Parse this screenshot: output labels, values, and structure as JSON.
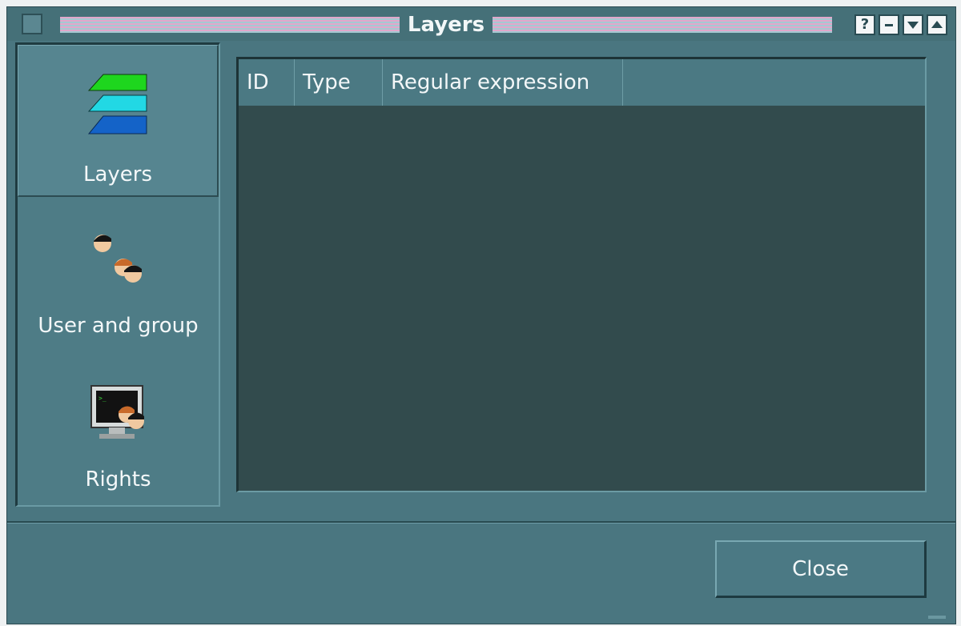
{
  "window": {
    "title": "Layers"
  },
  "titlebar": {
    "buttons": [
      "?",
      "−",
      "▾",
      "▴"
    ]
  },
  "sidebar": {
    "items": [
      {
        "label": "Layers",
        "icon": "layers-icon",
        "active": true
      },
      {
        "label": "User and group",
        "icon": "users-icon",
        "active": false
      },
      {
        "label": "Rights",
        "icon": "rights-icon",
        "active": false
      }
    ]
  },
  "table": {
    "columns": [
      "ID",
      "Type",
      "Regular expression"
    ],
    "rows": []
  },
  "footer": {
    "close_label": "Close"
  },
  "colors": {
    "window_bg": "#4a7680",
    "table_bg": "#324b4d",
    "header_bg": "#4b7983",
    "title_stripe_pink": "#e1a7cb",
    "title_stripe_blue": "#a5c9d2"
  }
}
